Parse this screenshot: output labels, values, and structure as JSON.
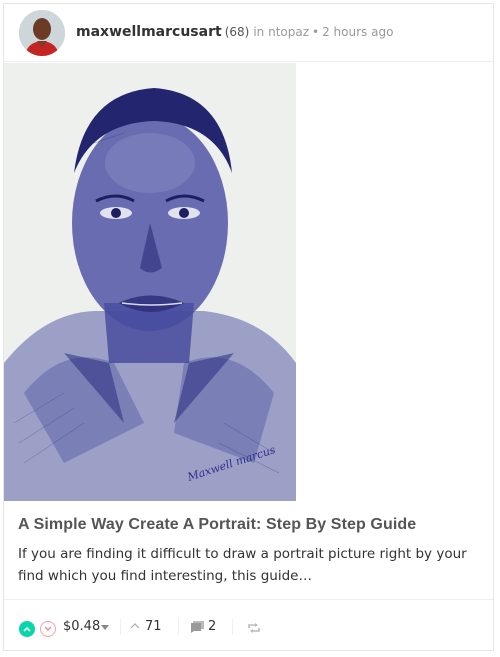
{
  "post": {
    "author": "maxwellmarcusart",
    "reputation": "(68)",
    "community_prefix": "in",
    "community": "ntopaz",
    "separator": "•",
    "time": "2 hours ago",
    "title": "A Simple Way Create A Portrait: Step By Step Guide",
    "summary": "If you are finding it difficult to draw a portrait picture right by your find which you find interesting, this guide…",
    "image_alt": "Ballpoint pen portrait drawing",
    "signature": "Maxwell marcus"
  },
  "footer": {
    "payout": "$0.48",
    "votes": "71",
    "comments": "2"
  },
  "colors": {
    "upvote": "#06d6a9",
    "downvote_border": "#f4a3a8",
    "ink": "#2e2f8a"
  }
}
